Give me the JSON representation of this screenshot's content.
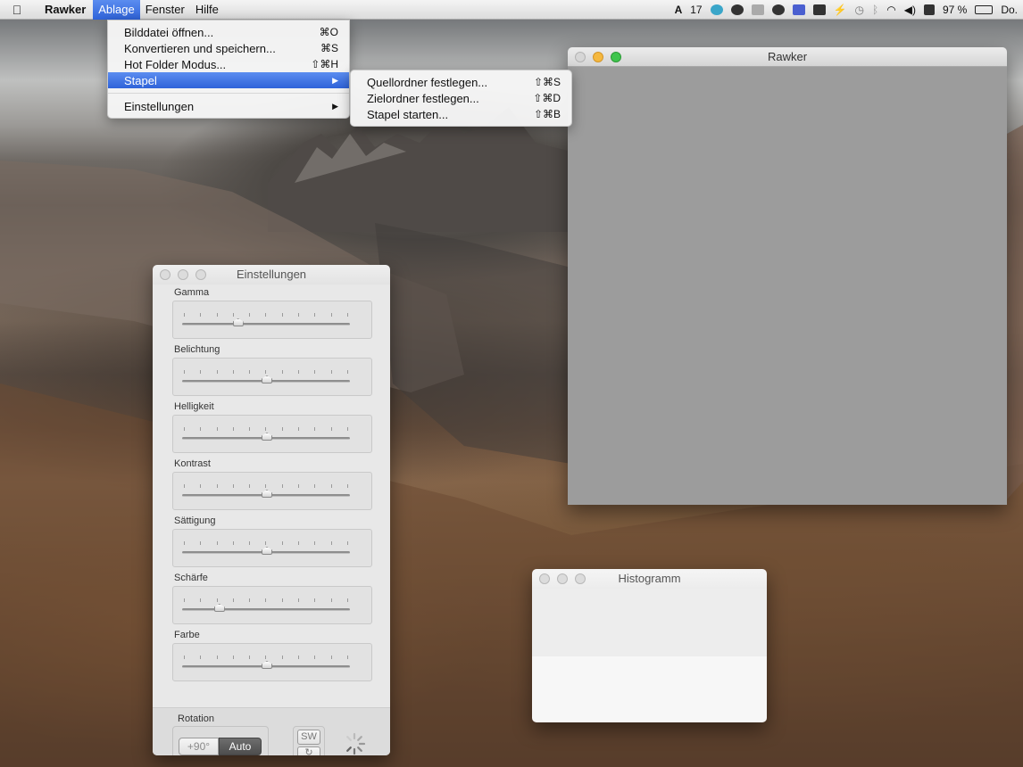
{
  "menubar": {
    "app_name": "Rawker",
    "menus": [
      "Ablage",
      "Fenster",
      "Hilfe"
    ],
    "status": {
      "notification_count": "17",
      "battery_percent": "97 %",
      "clock": "Do."
    }
  },
  "ablage_menu": {
    "items": [
      {
        "label": "Bilddatei öffnen...",
        "shortcut": "⌘O"
      },
      {
        "label": "Konvertieren und speichern...",
        "shortcut": "⌘S"
      },
      {
        "label": "Hot Folder Modus...",
        "shortcut": "⇧⌘H"
      },
      {
        "label": "Stapel",
        "shortcut": "▶"
      },
      {
        "label": "Einstellungen",
        "shortcut": "▶"
      }
    ]
  },
  "stapel_submenu": {
    "items": [
      {
        "label": "Quellordner festlegen...",
        "shortcut": "⇧⌘S"
      },
      {
        "label": "Zielordner festlegen...",
        "shortcut": "⇧⌘D"
      },
      {
        "label": "Stapel starten...",
        "shortcut": "⇧⌘B"
      }
    ]
  },
  "main_window": {
    "title": "Rawker"
  },
  "settings_window": {
    "title": "Einstellungen",
    "sliders": [
      {
        "label": "Gamma",
        "value": 0.33
      },
      {
        "label": "Belichtung",
        "value": 0.5
      },
      {
        "label": "Helligkeit",
        "value": 0.5
      },
      {
        "label": "Kontrast",
        "value": 0.5
      },
      {
        "label": "Sättigung",
        "value": 0.5
      },
      {
        "label": "Schärfe",
        "value": 0.22
      },
      {
        "label": "Farbe",
        "value": 0.5
      }
    ],
    "rotation": {
      "label": "Rotation",
      "plus90": "+90°",
      "auto": "Auto",
      "sw": "SW",
      "refresh": "↻"
    }
  },
  "histogram_window": {
    "title": "Histogramm"
  }
}
